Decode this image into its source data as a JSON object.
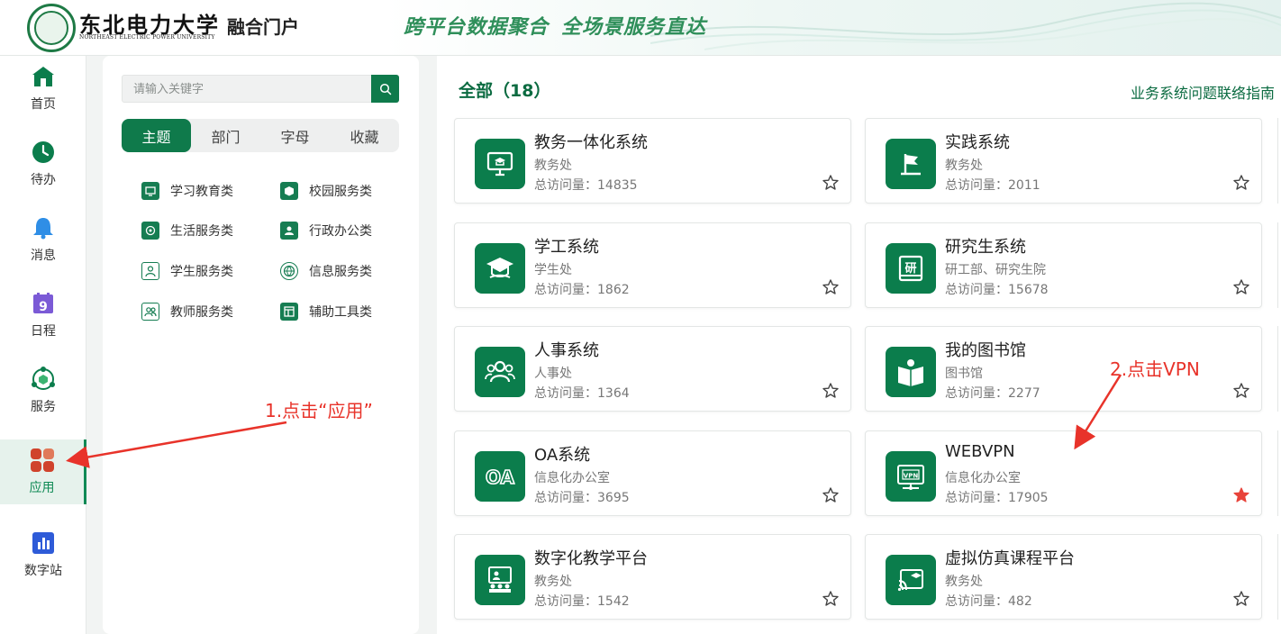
{
  "header": {
    "university_name_cn": "东北电力大学",
    "university_name_en": "NORTHEAST ELECTRIC POWER UNIVERSITY",
    "portal_title": "融合门户",
    "slogan_part1": "跨平台数据聚合",
    "slogan_part2": "全场景服务直达"
  },
  "leftnav": {
    "items": [
      {
        "label": "首页",
        "icon": "home-icon"
      },
      {
        "label": "待办",
        "icon": "clock-icon"
      },
      {
        "label": "消息",
        "icon": "bell-icon"
      },
      {
        "label": "日程",
        "icon": "calendar-icon"
      },
      {
        "label": "服务",
        "icon": "service-icon"
      },
      {
        "label": "应用",
        "icon": "apps-grid-icon",
        "active": true
      },
      {
        "label": "数字站",
        "icon": "bar-chart-icon"
      }
    ]
  },
  "category_panel": {
    "search_placeholder": "请输入关键字",
    "tabs": [
      "主题",
      "部门",
      "字母",
      "收藏"
    ],
    "active_tab": "主题",
    "categories": [
      {
        "label": "学习教育类",
        "icon": "learning-icon"
      },
      {
        "label": "校园服务类",
        "icon": "box-icon"
      },
      {
        "label": "生活服务类",
        "icon": "life-icon"
      },
      {
        "label": "行政办公类",
        "icon": "person-icon"
      },
      {
        "label": "学生服务类",
        "icon": "student-icon"
      },
      {
        "label": "信息服务类",
        "icon": "globe-icon"
      },
      {
        "label": "教师服务类",
        "icon": "teacher-icon"
      },
      {
        "label": "辅助工具类",
        "icon": "tools-icon"
      }
    ]
  },
  "main": {
    "title": "全部（18）",
    "guide_link": "业务系统问题联络指南",
    "apps": [
      {
        "name": "教务一体化系统",
        "dept": "教务处",
        "visits": "总访问量：14835",
        "icon": "monitor-graduation-icon",
        "favorited": false
      },
      {
        "name": "实践系统",
        "dept": "教务处",
        "visits": "总访问量：2011",
        "icon": "flag-icon",
        "favorited": false
      },
      {
        "name": "学工系统",
        "dept": "学生处",
        "visits": "总访问量：1862",
        "icon": "graduation-cap-icon",
        "favorited": false
      },
      {
        "name": "研究生系统",
        "dept": "研工部、研究生院",
        "visits": "总访问量：15678",
        "icon": "book-yan-icon",
        "favorited": false
      },
      {
        "name": "人事系统",
        "dept": "人事处",
        "visits": "总访问量：1364",
        "icon": "people-icon",
        "favorited": false
      },
      {
        "name": "我的图书馆",
        "dept": "图书馆",
        "visits": "总访问量：2277",
        "icon": "open-book-icon",
        "favorited": false
      },
      {
        "name": "OA系统",
        "dept": "信息化办公室",
        "visits": "总访问量：3695",
        "icon": "oa-icon",
        "favorited": false
      },
      {
        "name": "WEBVPN",
        "dept": "信息化办公室",
        "visits": "总访问量：17905",
        "icon": "vpn-icon",
        "favorited": true
      },
      {
        "name": "数字化教学平台",
        "dept": "教务处",
        "visits": "总访问量：1542",
        "icon": "classroom-icon",
        "favorited": false
      },
      {
        "name": "虚拟仿真课程平台",
        "dept": "教务处",
        "visits": "总访问量：482",
        "icon": "cast-icon",
        "favorited": false
      }
    ]
  },
  "annotations": {
    "step1": "1.点击“应用”",
    "step2": "2.点击VPN",
    "color": "#e8332a"
  },
  "colors": {
    "brand_green": "#0f7a4b",
    "favorite_star": "#e8433a"
  }
}
